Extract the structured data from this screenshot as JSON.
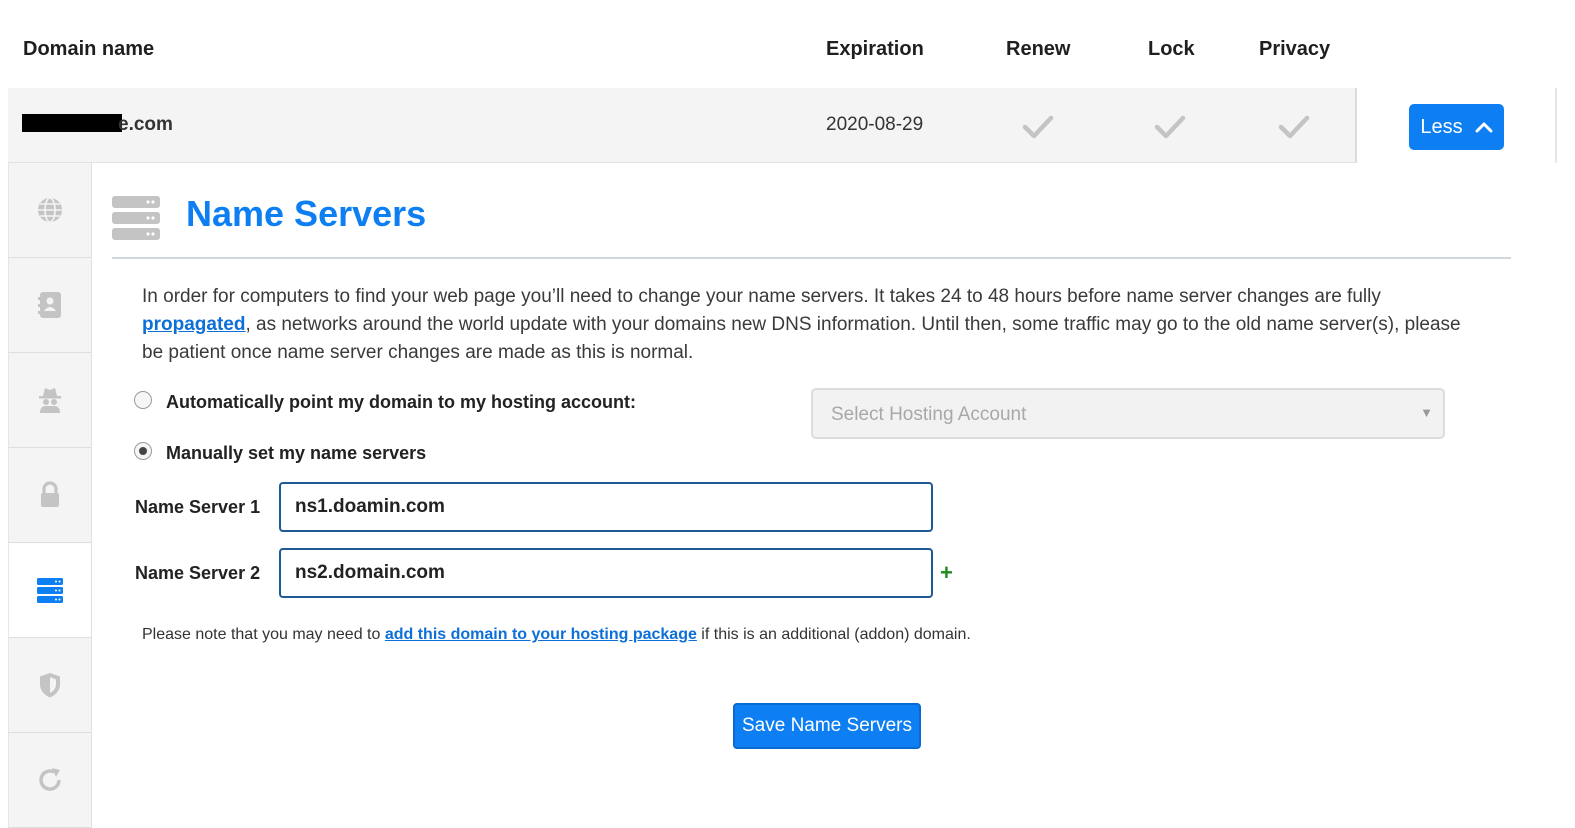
{
  "table_header": {
    "domain_name": "Domain name",
    "expiration": "Expiration",
    "renew": "Renew",
    "lock": "Lock",
    "privacy": "Privacy"
  },
  "domain_row": {
    "domain_suffix": "e.com",
    "expiration": "2020-08-29",
    "renew_icon": "check-icon",
    "lock_icon": "check-icon",
    "privacy_icon": "check-icon",
    "less_button": "Less"
  },
  "sidebar": {
    "tabs": [
      {
        "icon": "globe-icon",
        "active": false
      },
      {
        "icon": "contact-card-icon",
        "active": false
      },
      {
        "icon": "spy-icon",
        "active": false
      },
      {
        "icon": "lock-icon",
        "active": false
      },
      {
        "icon": "server-icon",
        "active": true
      },
      {
        "icon": "shield-icon",
        "active": false
      },
      {
        "icon": "refresh-icon",
        "active": false
      }
    ]
  },
  "panel": {
    "title": "Name Servers",
    "intro_part1": "In order for computers to find your web page you’ll need to change your name servers. It takes 24 to 48 hours before name server changes are fully ",
    "intro_link": "propagated",
    "intro_part2": ", as networks around the world update with your domains new DNS information. Until then, some traffic may go to the old name server(s), please be patient once name server changes are made as this is normal.",
    "option_auto": "Automatically point my domain to my hosting account:",
    "option_manual": "Manually set my name servers",
    "select_placeholder": "Select Hosting Account",
    "ns1_label": "Name Server 1",
    "ns1_value": "ns1.doamin.com",
    "ns2_label": "Name Server 2",
    "ns2_value": "ns2.domain.com",
    "add_symbol": "+",
    "note_part1": "Please note that you may need to ",
    "note_link": "add this domain to your hosting package",
    "note_part2": " if this is an additional (addon) domain.",
    "save_button": "Save Name Servers"
  },
  "colors": {
    "accent": "#0d7ff2",
    "icon_gray": "#c4c4c4",
    "plus_green": "#1f8a1f"
  }
}
